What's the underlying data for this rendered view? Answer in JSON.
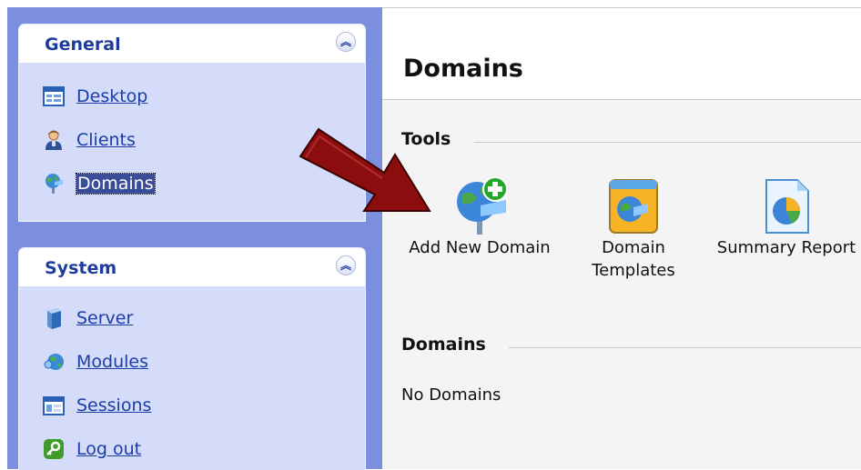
{
  "sidebar": {
    "general": {
      "title": "General",
      "items": [
        {
          "label": "Desktop",
          "icon": "desktop-icon"
        },
        {
          "label": "Clients",
          "icon": "clients-icon"
        },
        {
          "label": "Domains",
          "icon": "domains-icon",
          "selected": true
        }
      ]
    },
    "system": {
      "title": "System",
      "items": [
        {
          "label": "Server",
          "icon": "server-icon"
        },
        {
          "label": "Modules",
          "icon": "modules-icon"
        },
        {
          "label": "Sessions",
          "icon": "sessions-icon"
        },
        {
          "label": "Log out",
          "icon": "logout-icon"
        }
      ]
    }
  },
  "main": {
    "title": "Domains",
    "tools": {
      "heading": "Tools",
      "items": [
        {
          "label_line1": "Add New Domain",
          "label_line2": ""
        },
        {
          "label_line1": "Domain",
          "label_line2": "Templates"
        },
        {
          "label_line1": "Summary Report",
          "label_line2": ""
        }
      ]
    },
    "domains": {
      "heading": "Domains",
      "empty_text": "No Domains"
    }
  },
  "colors": {
    "sidebar_bg": "#7b8fde",
    "panel_bg": "#d4dcf9",
    "link": "#1a3da8",
    "panel_title": "#1f3c9c",
    "arrow": "#8b0d0d"
  }
}
